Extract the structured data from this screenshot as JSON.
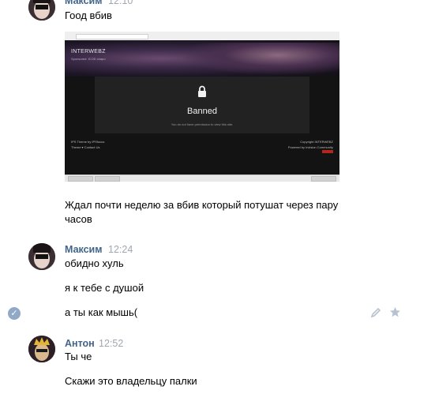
{
  "messages": [
    {
      "author": "Максим",
      "time": "12:10",
      "lines": [
        "Гоод вбив"
      ],
      "attachment": {
        "site_title": "INTERWEBZ",
        "site_subtitle": "Sponsored: ICOD chapo",
        "banned_title": "Banned",
        "banned_text": "You do not have permission to view this site.",
        "footer_left_1": "IPS Theme by IPSfocus",
        "footer_left_2": "Theme ▾    Contact Us",
        "footer_right_1": "Copyright INTERWEBZ",
        "footer_right_2": "Powered by Invision Community"
      },
      "after_text": "Ждал почти неделю за вбив который потушат через пару часов"
    },
    {
      "author": "Максим",
      "time": "12:24",
      "lines": [
        "обидно хуль",
        "я к тебе с душой",
        "а ты как мышь("
      ]
    },
    {
      "author": "Антон",
      "time": "12:52",
      "lines": [
        "Ты че",
        "Скажи это владельцу палки"
      ]
    }
  ],
  "icons": {
    "selected": "check-icon",
    "edit": "pencil-icon",
    "favorite": "star-icon"
  },
  "colors": {
    "author": "#42648b",
    "time": "#a0a7b0",
    "icon": "#b6c2d0"
  }
}
